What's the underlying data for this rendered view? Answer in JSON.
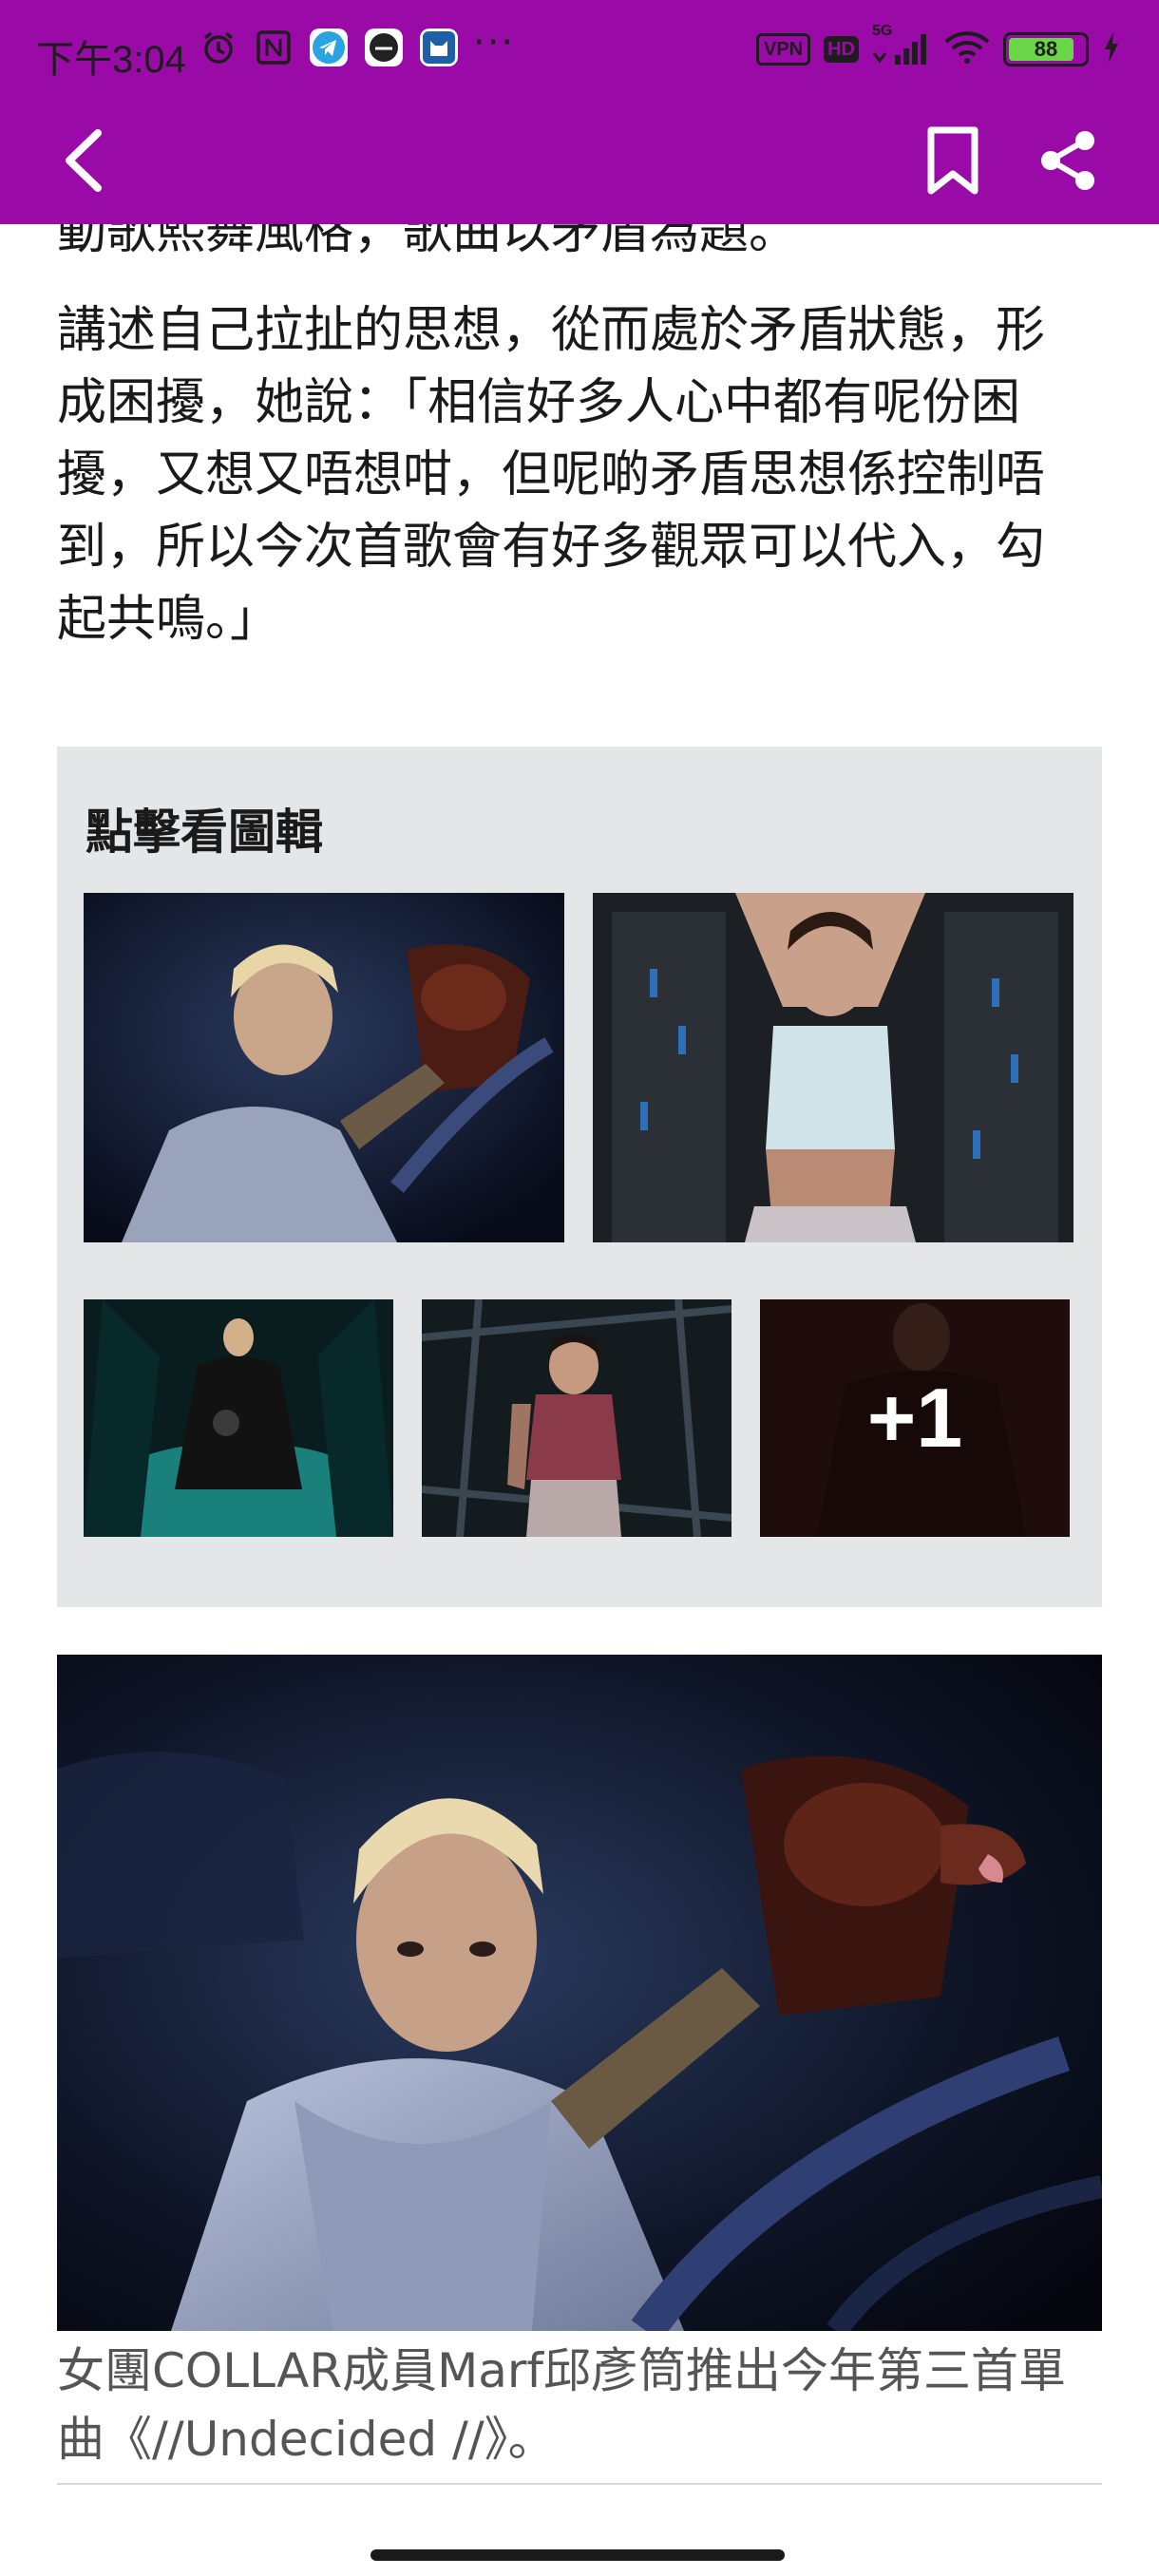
{
  "status_bar": {
    "time": "下午3:04",
    "overflow_dots": "···",
    "vpn": "VPN",
    "hd": "HD",
    "network": "5G",
    "battery_level": "88",
    "battery_fraction": 0.88
  },
  "app_bar": {
    "back_icon": "chevron-left-icon",
    "bookmark_icon": "bookmark-icon",
    "share_icon": "share-icon",
    "background_color": "#9a0aa6"
  },
  "article": {
    "partial_line": "動歌熙舞風格，歌曲以矛盾為題。",
    "paragraph": "講述自己拉扯的思想，從而處於矛盾狀態，形成困擾，她說：「相信好多人心中都有呢份困擾，又想又唔想咁，但呢啲矛盾思想係控制唔到，所以今次首歌會有好多觀眾可以代入，勾起共鳴。」"
  },
  "gallery": {
    "title": "點擊看圖輯",
    "more_count": "+1"
  },
  "hero": {
    "caption": "女團COLLAR成員Marf邱彥筒推出今年第三首單曲《//Undecided //》。"
  }
}
